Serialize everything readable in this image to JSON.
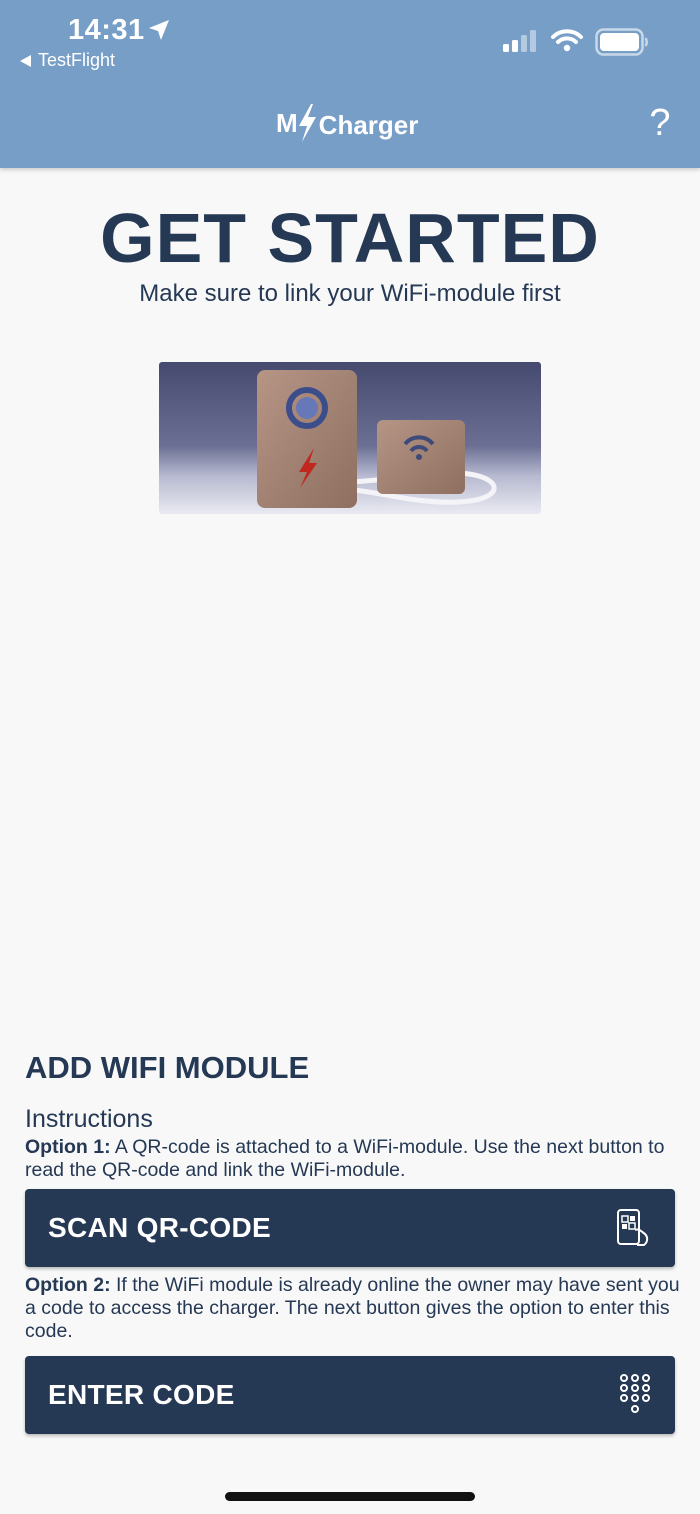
{
  "status_bar": {
    "time": "14:31",
    "back_app": "TestFlight"
  },
  "header": {
    "logo_prefix": "M",
    "logo_text": "Charger",
    "help_label": "?"
  },
  "main": {
    "title": "GET STARTED",
    "subtitle": "Make sure to link your WiFi-module first"
  },
  "add_module": {
    "title": "ADD WIFI MODULE",
    "instructions_title": "Instructions",
    "option1_label": "Option 1:",
    "option1_text": " A QR-code is attached to a WiFi-module. Use the next button to read the QR-code and link the WiFi-module.",
    "scan_button_label": "SCAN QR-CODE",
    "option2_label": "Option 2:",
    "option2_text": " If the WiFi module is already online the owner may have sent you a code to access the charger. The next button gives the option to enter this code.",
    "enter_button_label": "ENTER CODE"
  },
  "icons": {
    "location": "location-arrow-icon",
    "signal": "cellular-signal-icon",
    "wifi": "wifi-icon",
    "battery": "battery-icon",
    "scan": "phone-qr-scan-icon",
    "keypad": "keypad-icon"
  },
  "colors": {
    "header_bg": "#779ec6",
    "primary_navy": "#253854",
    "page_bg": "#f8f8f8",
    "accent_red": "#c0271f"
  }
}
